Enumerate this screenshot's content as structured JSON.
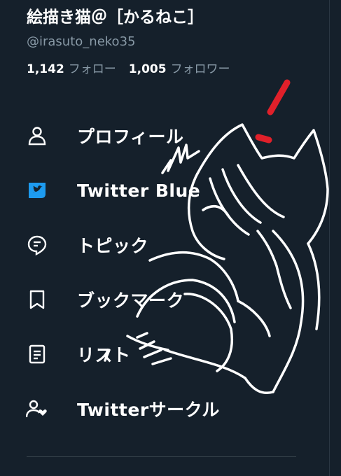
{
  "profile": {
    "display_name": "絵描き猫＠［かるねこ］",
    "handle": "@irasuto_neko35",
    "following_count": "1,142",
    "following_label": "フォロー",
    "followers_count": "1,005",
    "followers_label": "フォロワー"
  },
  "menu": {
    "items": [
      {
        "label": "プロフィール",
        "icon": "person-icon"
      },
      {
        "label": "Twitter Blue",
        "icon": "twitter-blue-icon"
      },
      {
        "label": "トピック",
        "icon": "topics-icon"
      },
      {
        "label": "ブックマーク",
        "icon": "bookmark-icon"
      },
      {
        "label": "リスト",
        "icon": "list-icon"
      },
      {
        "label": "Twitterサークル",
        "icon": "circle-people-icon"
      }
    ]
  },
  "colors": {
    "background": "#15202b",
    "muted_text": "#8899a6",
    "accent_blue": "#1d9bf0",
    "doodle_red": "#e0202a"
  }
}
